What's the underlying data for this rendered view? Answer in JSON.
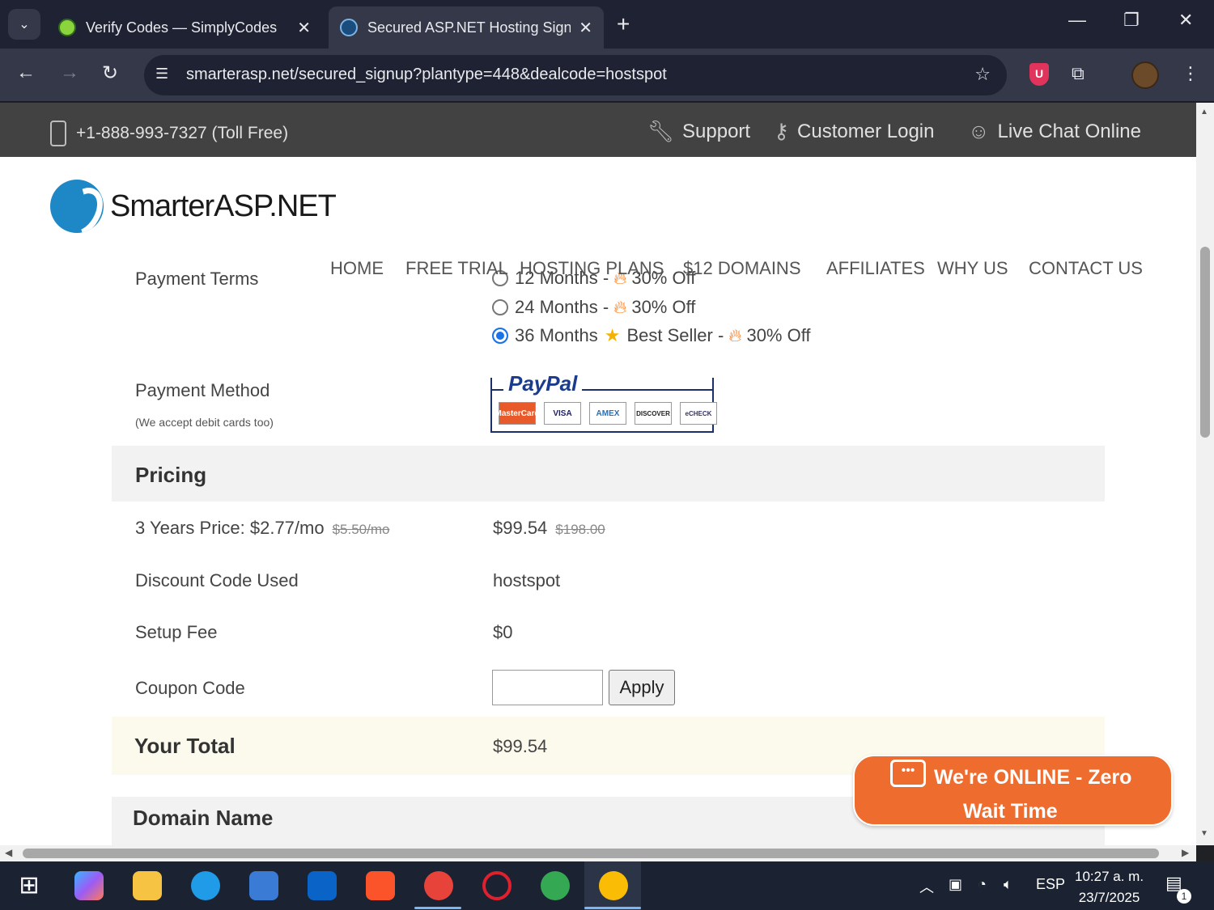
{
  "browser": {
    "tabs": [
      {
        "title": "Verify Codes — SimplyCodes",
        "active": false
      },
      {
        "title": "Secured ASP.NET Hosting Signu",
        "active": true
      }
    ],
    "url": "smarterasp.net/secured_signup?plantype=448&dealcode=hostspot"
  },
  "topbar": {
    "phone": "+1-888-993-7327 (Toll Free)",
    "support": "Support",
    "customer_login": "Customer Login",
    "live_chat": "Live Chat Online"
  },
  "brand": {
    "name": "SmarterASP.NET",
    "color": "#1e88c7"
  },
  "nav": [
    "HOME",
    "FREE TRIAL",
    "HOSTING PLANS",
    "$12 DOMAINS",
    "AFFILIATES",
    "WHY US",
    "CONTACT US"
  ],
  "payment_terms": {
    "label": "Payment Terms",
    "options": [
      {
        "months": "12 Months -",
        "discount": "30% Off",
        "selected": false
      },
      {
        "months": "24 Months -",
        "discount": "30% Off",
        "selected": false
      },
      {
        "months": "36 Months",
        "badge": "Best Seller -",
        "discount": "30% Off",
        "selected": true
      }
    ]
  },
  "payment_method": {
    "label": "Payment Method",
    "note": "(We accept debit cards too)",
    "provider": "PayPal",
    "cards": [
      "MasterCard",
      "VISA",
      "AMEX",
      "DISCOVER",
      "eCHECK"
    ]
  },
  "pricing": {
    "title": "Pricing",
    "price_label": "3 Years Price: $2.77/mo",
    "price_old_mo": "$5.50/mo",
    "price_total": "$99.54",
    "price_old_total": "$198.00",
    "discount_label": "Discount Code Used",
    "discount_value": "hostspot",
    "setup_label": "Setup Fee",
    "setup_value": "$0",
    "coupon_label": "Coupon Code",
    "coupon_value": "",
    "apply_label": "Apply",
    "total_label": "Your Total",
    "total_value": "$99.54"
  },
  "domain": {
    "title": "Domain Name"
  },
  "chat_widget": {
    "line1": "We're ONLINE - Zero",
    "line2": "Wait Time",
    "color": "#ef6c2f"
  },
  "taskbar": {
    "lang": "ESP",
    "time": "10:27 a. m.",
    "date": "23/7/2025",
    "notifications": "1"
  }
}
